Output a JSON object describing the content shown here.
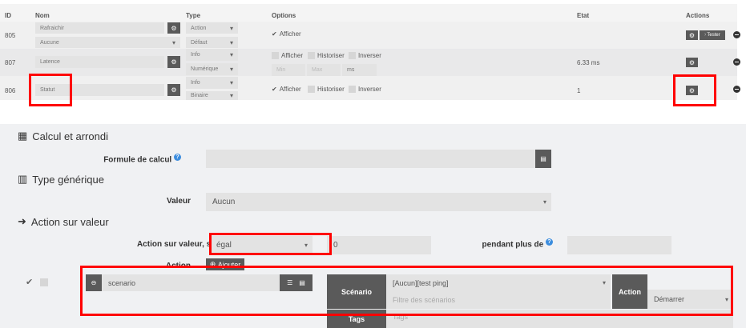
{
  "table": {
    "headers": {
      "id": "ID",
      "nom": "Nom",
      "type": "Type",
      "options": "Options",
      "etat": "Etat",
      "actions": "Actions"
    },
    "rows": [
      {
        "id": "805",
        "name": "Rafraichir",
        "sub": "Aucune",
        "type": "Action",
        "subtype": "Défaut",
        "afficher": "Afficher",
        "etat": "",
        "tester": "Tester"
      },
      {
        "id": "807",
        "name": "Latence",
        "type": "Info",
        "subtype": "Numérique",
        "afficher": "Afficher",
        "historiser": "Historiser",
        "inverser": "Inverser",
        "min": "Min",
        "max": "Max",
        "unit": "ms",
        "etat": "6.33 ms"
      },
      {
        "id": "806",
        "name": "Statut",
        "type": "Info",
        "subtype": "Binaire",
        "afficher": "Afficher",
        "historiser": "Historiser",
        "inverser": "Inverser",
        "etat": "1"
      }
    ]
  },
  "panel": {
    "calc_title": "Calcul et arrondi",
    "formula_label": "Formule de calcul",
    "formula_value": "",
    "generic_title": "Type générique",
    "valeur_label": "Valeur",
    "valeur_value": "Aucun",
    "action_title": "Action sur valeur",
    "action_if_label": "Action sur valeur, si",
    "operator": "égal",
    "compare_value": "0",
    "during_label": "pendant plus de",
    "action_label": "Action",
    "add_label": "Ajouter",
    "cmd_value": "scenario",
    "scenario_label": "Scénario",
    "scenario_value": "[Aucun][test ping]",
    "scenario_filter_placeholder": "Filtre des scénarios",
    "action2_label": "Action",
    "action2_value": "Démarrer",
    "tags_label": "Tags",
    "tags_placeholder": "Tags"
  }
}
